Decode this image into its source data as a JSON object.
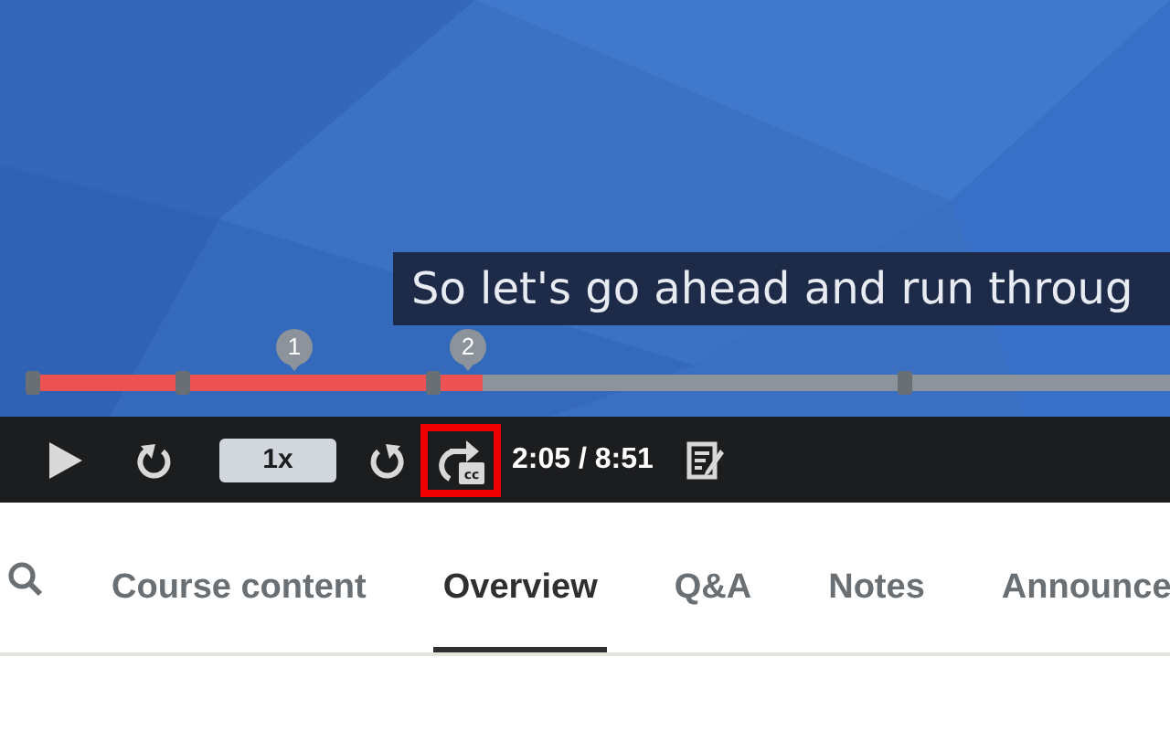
{
  "video": {
    "kind": "picture",
    "caption": "So let's go ahead and run throug",
    "progress": {
      "level": 0.4
    },
    "bookmarks": [
      "1",
      "2"
    ]
  },
  "controls": {
    "speed": "1x",
    "caption_badge": "cc",
    "time": "2:05 / 8:51",
    "captions_highlighted": true
  },
  "tabs": [
    {
      "label": "Course content",
      "selected": false
    },
    {
      "label": "Overview",
      "selected": true
    },
    {
      "label": "Q&A",
      "selected": false
    },
    {
      "label": "Notes",
      "selected": false
    },
    {
      "label": "Announce",
      "selected": false
    }
  ]
}
